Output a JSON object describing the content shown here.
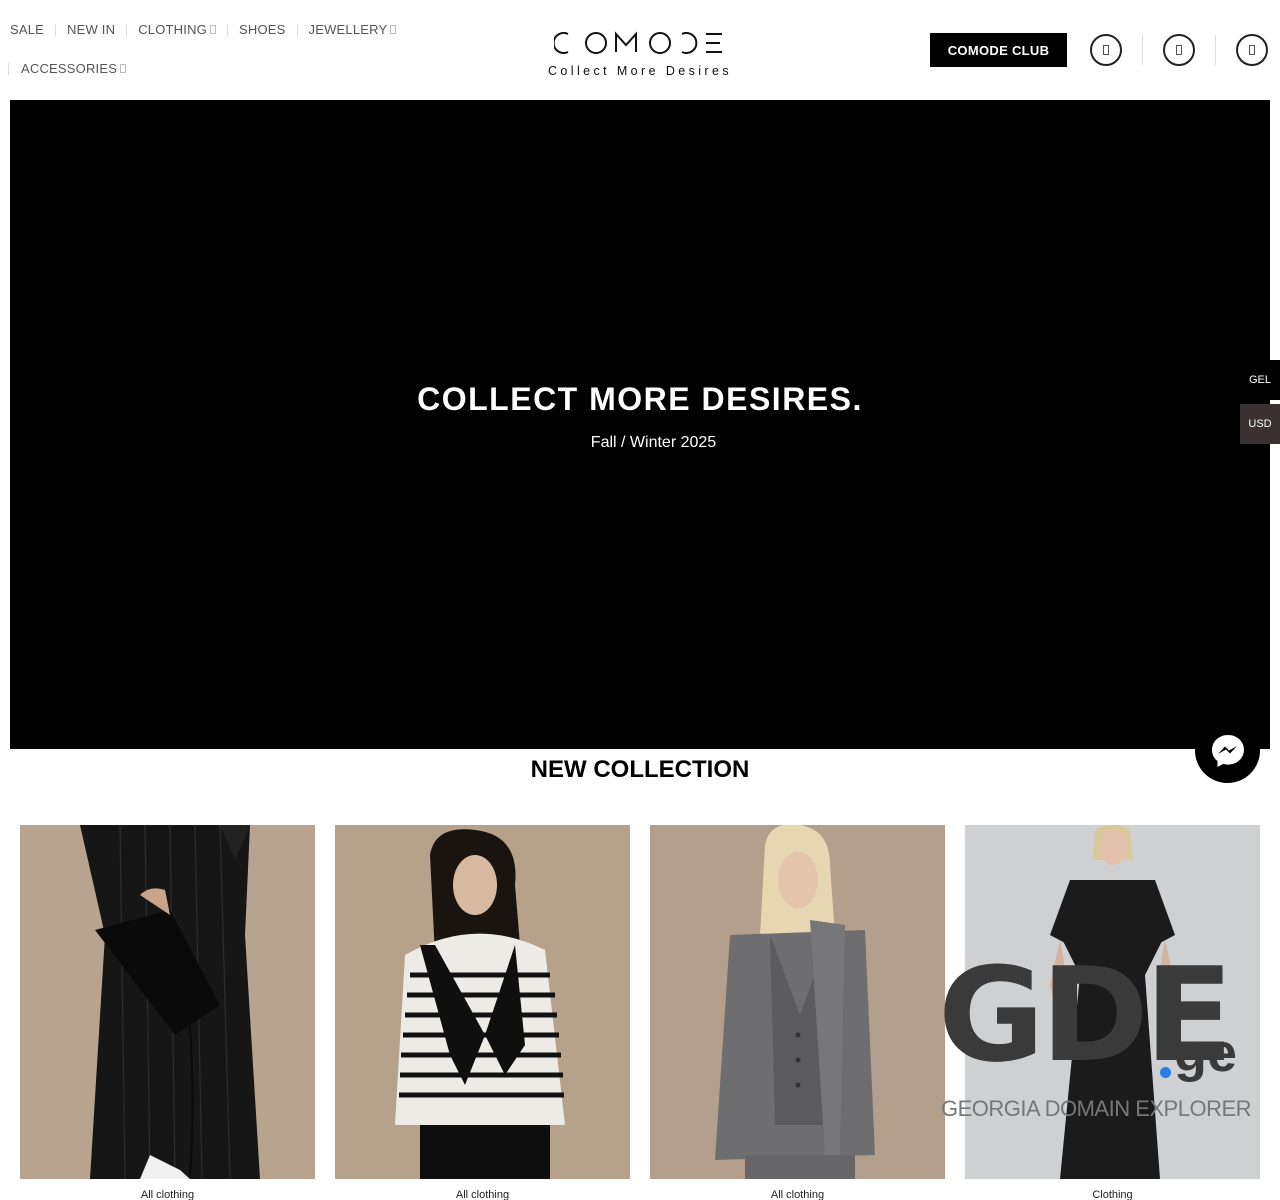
{
  "nav": {
    "row1": [
      {
        "label": "SALE",
        "dropdown": false
      },
      {
        "label": "NEW IN",
        "dropdown": false
      },
      {
        "label": "CLOTHING",
        "dropdown": true
      },
      {
        "label": "SHOES",
        "dropdown": false
      },
      {
        "label": "JEWELLERY",
        "dropdown": true
      }
    ],
    "row2": [
      {
        "label": "ACCESSORIES",
        "dropdown": true
      }
    ]
  },
  "brand": {
    "logo_text": "COMODE",
    "tagline": "Collect More Desires"
  },
  "header": {
    "club_button": "COMODE CLUB",
    "icons": [
      "account-icon",
      "wishlist-icon",
      "cart-icon"
    ]
  },
  "hero": {
    "title": "COLLECT MORE DESIRES.",
    "subtitle": "Fall / Winter 2025"
  },
  "currency": {
    "options": [
      "GEL",
      "USD"
    ]
  },
  "section": {
    "title": "NEW COLLECTION"
  },
  "products": [
    {
      "category": "All clothing"
    },
    {
      "category": "All clothing"
    },
    {
      "category": "All clothing"
    },
    {
      "category": "Clothing"
    }
  ],
  "watermark": {
    "logo": "GDE",
    "suffix": "ge",
    "subtitle": "GEORGIA DOMAIN EXPLORER"
  },
  "colors": {
    "accent": "#000000",
    "usd_bg": "#3a3232",
    "watermark_dot": "#2d7de0"
  }
}
